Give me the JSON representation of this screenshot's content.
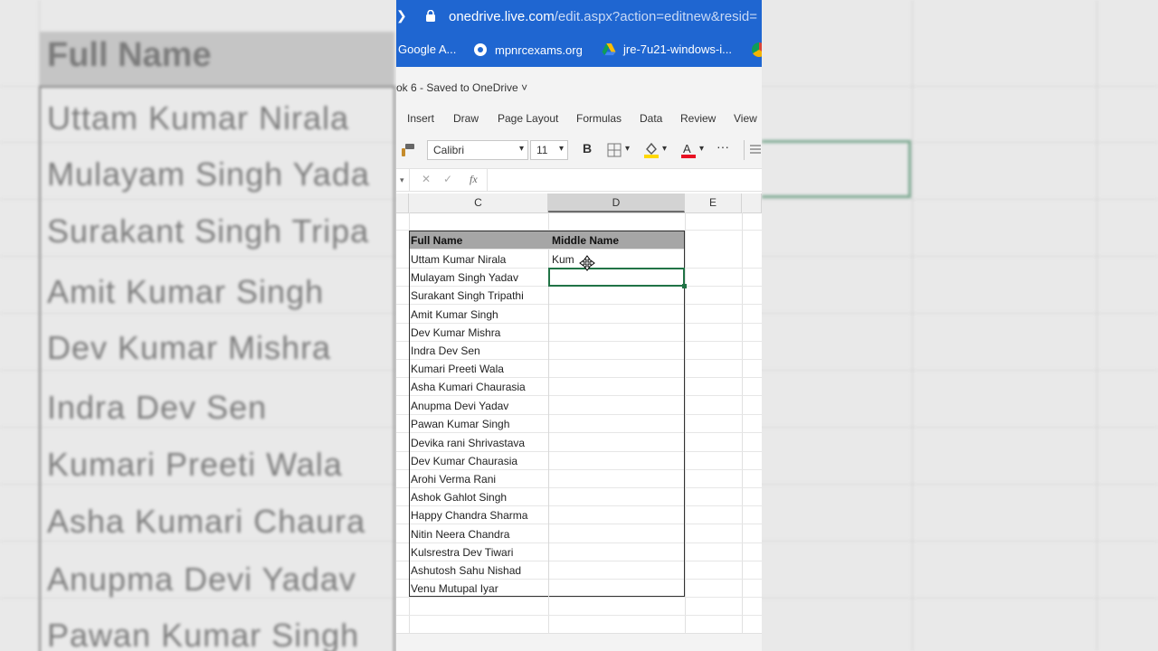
{
  "browser": {
    "url_host": "onedrive.live.com",
    "url_rest": "/edit.aspx?action=editnew&resid=",
    "bookmarks": [
      {
        "label": "Google A...",
        "icon": "google-apps-icon"
      },
      {
        "label": "mpnrcexams.org",
        "icon": "globe-icon"
      },
      {
        "label": "jre-7u21-windows-i...",
        "icon": "google-drive-icon"
      }
    ]
  },
  "doc": {
    "title": "ok 6  -  Saved to OneDrive ˅"
  },
  "ribbon": {
    "tabs": [
      "Insert",
      "Draw",
      "Page Layout",
      "Formulas",
      "Data",
      "Review",
      "View"
    ]
  },
  "toolbar": {
    "font": "Calibri",
    "size": "11",
    "bold": "B",
    "more": "···"
  },
  "formula_bar": {
    "cancel": "✕",
    "enter": "✓",
    "fx": "fx"
  },
  "columns": [
    "C",
    "D",
    "E"
  ],
  "sheet": {
    "headers": {
      "full_name": "Full Name",
      "middle_name": "Middle Name"
    },
    "rows": [
      {
        "full": "Uttam Kumar Nirala",
        "middle": "Kum"
      },
      {
        "full": "Mulayam Singh Yadav",
        "middle": ""
      },
      {
        "full": "Surakant Singh Tripathi",
        "middle": ""
      },
      {
        "full": "Amit Kumar Singh",
        "middle": ""
      },
      {
        "full": "Dev Kumar Mishra",
        "middle": ""
      },
      {
        "full": "Indra Dev Sen",
        "middle": ""
      },
      {
        "full": "Kumari Preeti Wala",
        "middle": ""
      },
      {
        "full": "Asha Kumari Chaurasia",
        "middle": ""
      },
      {
        "full": "Anupma Devi Yadav",
        "middle": ""
      },
      {
        "full": "Pawan Kumar Singh",
        "middle": ""
      },
      {
        "full": "Devika rani Shrivastava",
        "middle": ""
      },
      {
        "full": "Dev Kumar Chaurasia",
        "middle": ""
      },
      {
        "full": "Arohi Verma Rani",
        "middle": ""
      },
      {
        "full": "Ashok Gahlot Singh",
        "middle": ""
      },
      {
        "full": "Happy Chandra Sharma",
        "middle": ""
      },
      {
        "full": "Nitin Neera Chandra",
        "middle": ""
      },
      {
        "full": "Kulsrestra Dev Tiwari",
        "middle": ""
      },
      {
        "full": "Ashutosh Sahu Nishad",
        "middle": ""
      },
      {
        "full": "Venu Mutupal Iyar",
        "middle": ""
      }
    ]
  },
  "background": {
    "header": "Full Name",
    "names": [
      "Uttam Kumar Nirala",
      "Mulayam Singh Yada",
      "Surakant Singh Tripa",
      "Amit Kumar Singh",
      "Dev Kumar Mishra",
      "Indra Dev Sen",
      "Kumari Preeti Wala",
      "Asha Kumari Chaura",
      "Anupma Devi Yadav",
      "Pawan Kumar Singh"
    ]
  },
  "colors": {
    "browser_blue": "#1f66d1",
    "excel_green": "#217346",
    "header_gray": "#a6a6a6"
  }
}
